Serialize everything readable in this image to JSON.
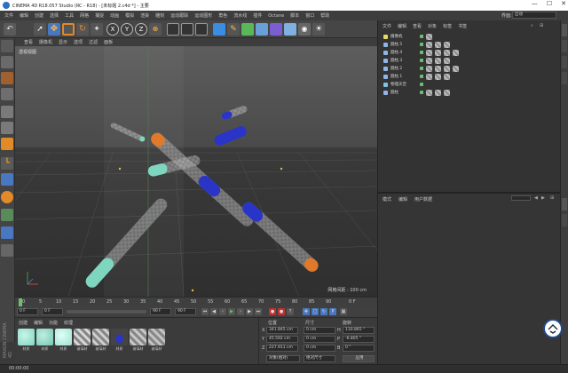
{
  "window": {
    "title": "CINEMA 4D R18.057 Studio (RC - R18) - [未标题 2.c4d *] - 主要",
    "controls": [
      "—",
      "☐",
      "✕"
    ]
  },
  "menu": [
    "文件",
    "编辑",
    "创建",
    "选择",
    "工具",
    "网格",
    "捕捉",
    "动画",
    "模拟",
    "渲染",
    "雕刻",
    "运动跟踪",
    "运动图形",
    "角色",
    "流水线",
    "插件",
    "Octane",
    "脚本",
    "窗口",
    "帮助"
  ],
  "layout": {
    "label": "界面:",
    "value": "启动"
  },
  "viewport": {
    "menu": [
      "查看",
      "摄像机",
      "显示",
      "选项",
      "过滤",
      "面板"
    ],
    "label": "透视视图",
    "grid_label": "网格间距 : 100 cm"
  },
  "timeline": {
    "ticks": [
      "0",
      "5",
      "10",
      "15",
      "20",
      "25",
      "30",
      "35",
      "40",
      "45",
      "50",
      "55",
      "60",
      "65",
      "70",
      "75",
      "80",
      "85",
      "90"
    ],
    "end_label": "0 F"
  },
  "transport": {
    "current_frame": "0 F",
    "start_frame": "0 F",
    "end_frame": "90 F",
    "end_frame2": "90 F"
  },
  "materials": {
    "menu": [
      "创建",
      "编辑",
      "功能",
      "纹理"
    ],
    "items": [
      {
        "name": "材质",
        "color": "#7fd6c0"
      },
      {
        "name": "材质",
        "color": "#74c7b2"
      },
      {
        "name": "材质",
        "color": "#9de0cf"
      },
      {
        "name": "玻璃材",
        "color": "#d8d8d8"
      },
      {
        "name": "玻璃材",
        "color": "#cfcfcf"
      },
      {
        "name": "材质",
        "color": "#2a35c8"
      },
      {
        "name": "玻璃材",
        "color": "#c9c9c9"
      },
      {
        "name": "玻璃材",
        "color": "#c4c4c4"
      }
    ]
  },
  "coords": {
    "headers": [
      "位置",
      "尺寸",
      "旋转"
    ],
    "rows": [
      {
        "axis": "X",
        "pos": "341.845 cm",
        "size": "0 cm",
        "rot_axis": "H",
        "rot": "110.865 °"
      },
      {
        "axis": "Y",
        "pos": "45.592 cm",
        "size": "0 cm",
        "rot_axis": "P",
        "rot": "-6.805 °"
      },
      {
        "axis": "Z",
        "pos": "227.911 cm",
        "size": "0 cm",
        "rot_axis": "B",
        "rot": "0 °"
      }
    ],
    "mode": "对象(相对)",
    "size_mode": "绝对尺寸",
    "apply": "应用"
  },
  "objects": {
    "menu": [
      "文件",
      "编辑",
      "查看",
      "对象",
      "标签",
      "书签"
    ],
    "rows": [
      {
        "name": "摄像机",
        "color": "#e8d86a"
      },
      {
        "name": "圆柱.5",
        "color": "#8fb4e8"
      },
      {
        "name": "圆柱.4",
        "color": "#8fb4e8"
      },
      {
        "name": "圆柱.3",
        "color": "#8fb4e8"
      },
      {
        "name": "圆柱.2",
        "color": "#8fb4e8"
      },
      {
        "name": "圆柱.1",
        "color": "#8fb4e8"
      },
      {
        "name": "物理天空",
        "color": "#7ec2e8"
      },
      {
        "name": "圆柱",
        "color": "#8fb4e8"
      }
    ]
  },
  "attributes": {
    "menu": [
      "模式",
      "编辑",
      "用户数据"
    ]
  },
  "status": {
    "time": "00:00:00"
  },
  "side_label": "MAXON CINEMA 4D"
}
